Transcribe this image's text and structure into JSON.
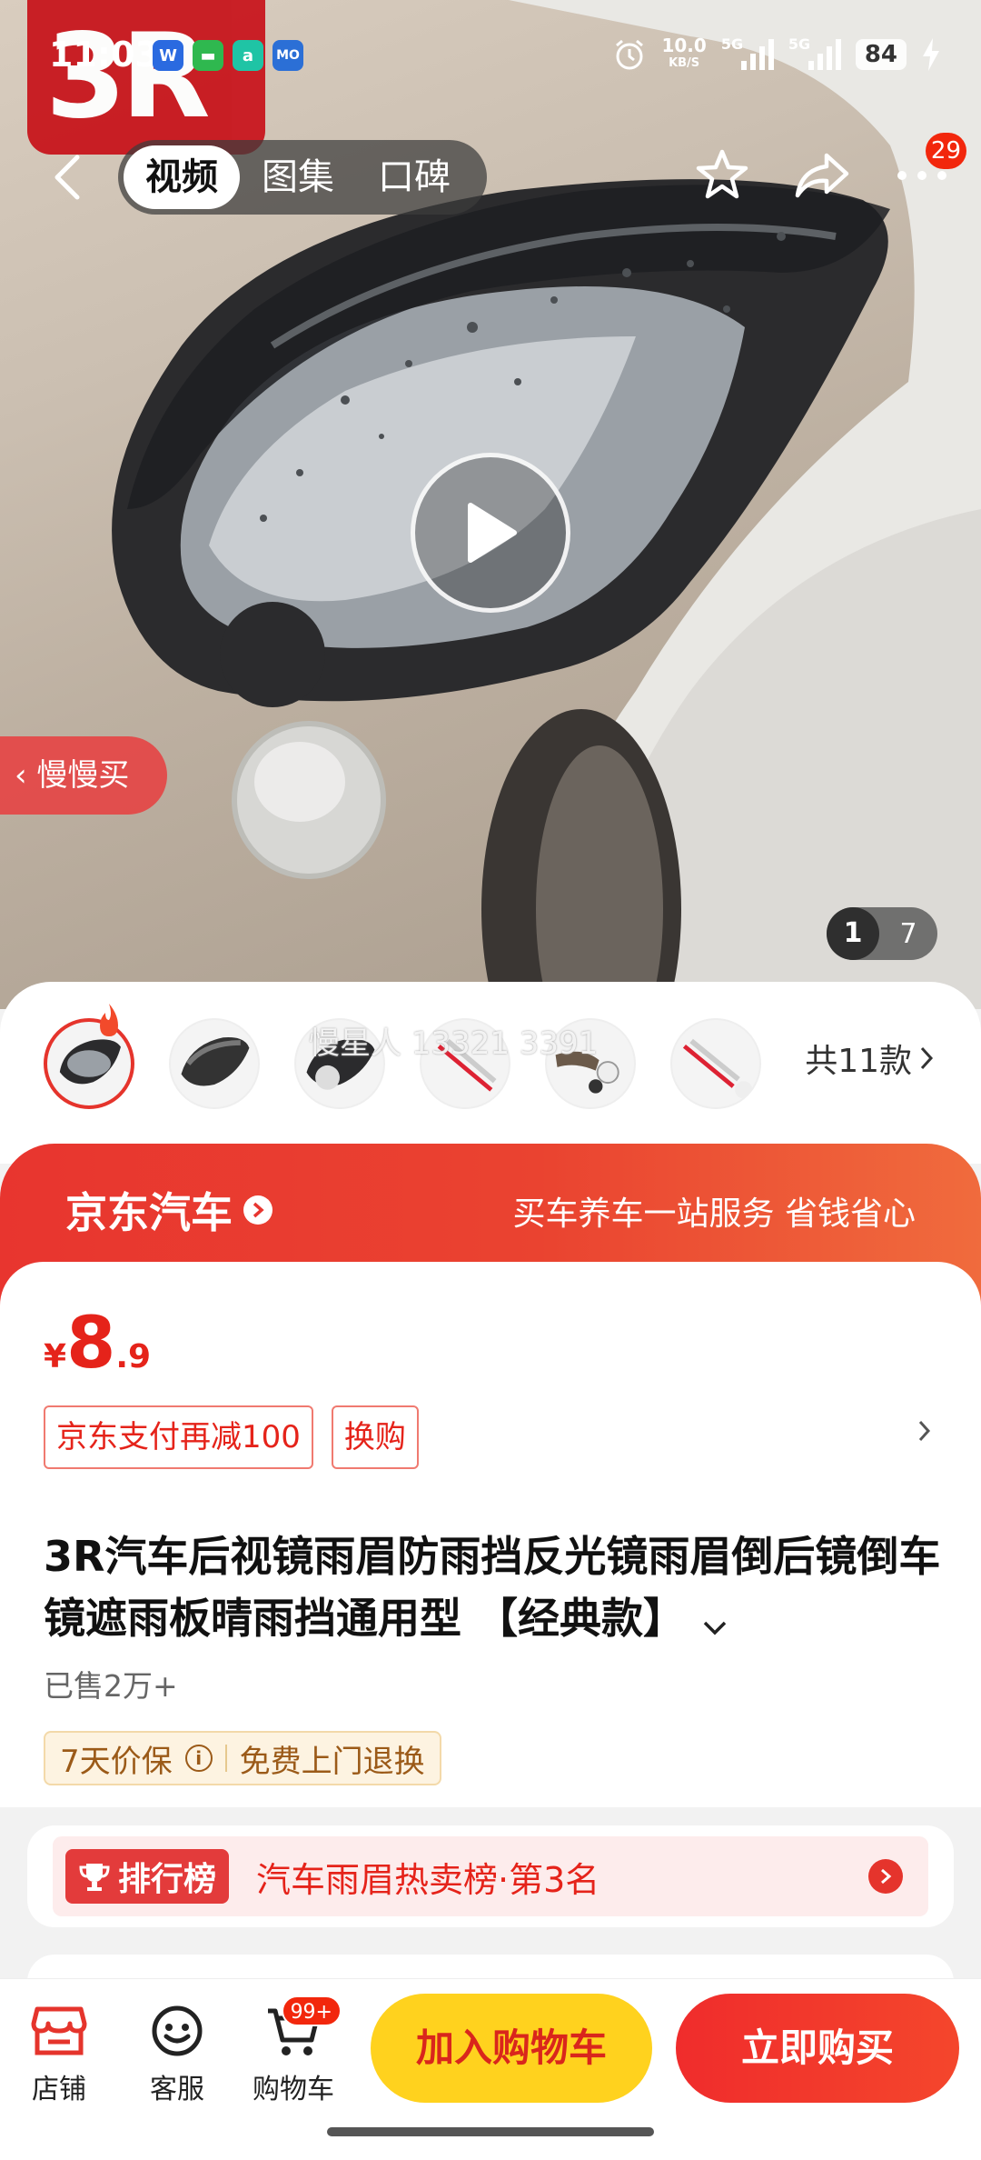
{
  "status_bar": {
    "time": "11:03",
    "net_speed_value": "10.0",
    "net_speed_unit": "KB/S",
    "signal_1": "5G",
    "signal_2": "5G",
    "battery": "84",
    "app_icons": [
      {
        "name": "weibo-icon",
        "glyph": "W",
        "color": "#2a6ae0"
      },
      {
        "name": "message-icon",
        "glyph": "▬",
        "color": "#2fb84f"
      },
      {
        "name": "a-app-icon",
        "glyph": "a",
        "color": "#1fc4a5"
      },
      {
        "name": "mo-app-icon",
        "glyph": "MO",
        "color": "#2b6fd6"
      }
    ]
  },
  "hero": {
    "logo_text": "3R",
    "tabs": [
      "视频",
      "图集",
      "口碑"
    ],
    "active_tab": "视频",
    "more_badge": "29",
    "slow_buy": "慢慢买",
    "image_index": "1",
    "image_total": "7"
  },
  "variants": {
    "watermark": "慢星人 13321 3391",
    "total": "共11款"
  },
  "jd_banner": {
    "title": "京东汽车",
    "slogan": "买车养车一站服务 省钱省心"
  },
  "price": {
    "currency": "¥",
    "integer": "8",
    "decimal": ".9"
  },
  "promos": [
    "京东支付再减100",
    "换购"
  ],
  "product": {
    "title": "3R汽车后视镜雨眉防雨挡反光镜雨眉倒后镜倒车镜遮雨板晴雨挡通用型 【经典款】",
    "sold": "已售2万+"
  },
  "guarantee": {
    "price_protect": "7天价保",
    "return": "免费上门退换"
  },
  "ranking": {
    "badge": "排行榜",
    "text": "汽车雨眉热卖榜·第3名"
  },
  "bottom_bar": {
    "shop": "店铺",
    "service": "客服",
    "cart": "购物车",
    "cart_badge": "99+",
    "add_to_cart": "加入购物车",
    "buy_now": "立即购买"
  },
  "colors": {
    "jd_red": "#e5231a",
    "cart_yellow": "#ffd21e"
  }
}
